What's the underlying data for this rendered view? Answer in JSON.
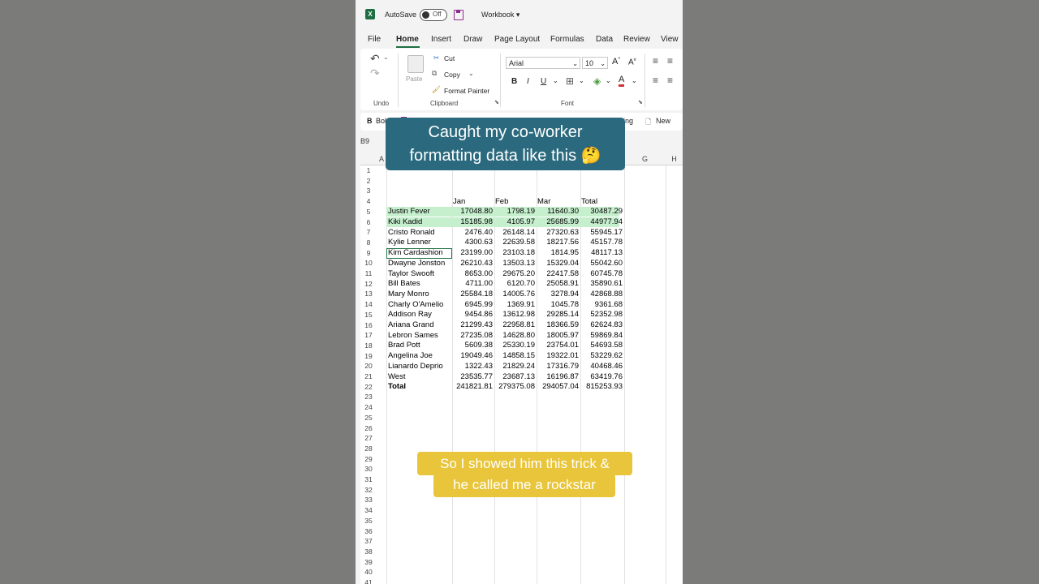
{
  "titlebar": {
    "autosave_label": "AutoSave",
    "toggle_state": "Off",
    "doc_title": "Workbook ▾"
  },
  "menu": [
    "File",
    "Home",
    "Insert",
    "Draw",
    "Page Layout",
    "Formulas",
    "Data",
    "Review",
    "View"
  ],
  "ribbon": {
    "undo_label": "Undo",
    "paste_label": "Paste",
    "cut_label": "Cut",
    "copy_label": "Copy",
    "format_painter_label": "Format Painter",
    "clipboard_label": "Clipboard",
    "font_name": "Arial",
    "font_size": "10",
    "font_group_label": "Font"
  },
  "quick_access": {
    "bold_label": "Bold",
    "spelling_label": "Spelling",
    "new_label": "New"
  },
  "name_box": "B9",
  "columns": [
    "A",
    "B",
    "C",
    "D",
    "E",
    "F",
    "G",
    "H"
  ],
  "headers": {
    "jan": "Jan",
    "feb": "Feb",
    "mar": "Mar",
    "total": "Total"
  },
  "rows": [
    [
      "Justin Fever",
      "17048.80",
      "1798.19",
      "11640.30",
      "30487.29"
    ],
    [
      "Kiki Kadid",
      "15185.98",
      "4105.97",
      "25685.99",
      "44977.94"
    ],
    [
      "Cristo Ronald",
      "2476.40",
      "26148.14",
      "27320.63",
      "55945.17"
    ],
    [
      "Kylie Lenner",
      "4300.63",
      "22639.58",
      "18217.56",
      "45157.78"
    ],
    [
      "Kim Cardashion",
      "23199.00",
      "23103.18",
      "1814.95",
      "48117.13"
    ],
    [
      "Dwayne Jonston",
      "26210.43",
      "13503.13",
      "15329.04",
      "55042.60"
    ],
    [
      "Taylor Swooft",
      "8653.00",
      "29675.20",
      "22417.58",
      "60745.78"
    ],
    [
      "Bill Bates",
      "4711.00",
      "6120.70",
      "25058.91",
      "35890.61"
    ],
    [
      "Mary Monro",
      "25584.18",
      "14005.76",
      "3278.94",
      "42868.88"
    ],
    [
      "Charly O'Amelio",
      "6945.99",
      "1369.91",
      "1045.78",
      "9361.68"
    ],
    [
      "Addison Ray",
      "9454.86",
      "13612.98",
      "29285.14",
      "52352.98"
    ],
    [
      "Ariana Grand",
      "21299.43",
      "22958.81",
      "18366.59",
      "62624.83"
    ],
    [
      "Lebron Sames",
      "27235.08",
      "14628.80",
      "18005.97",
      "59869.84"
    ],
    [
      "Brad Pott",
      "5609.38",
      "25330.19",
      "23754.01",
      "54693.58"
    ],
    [
      "Angelina Joe",
      "19049.46",
      "14858.15",
      "19322.01",
      "53229.62"
    ],
    [
      "Lianardo Deprio",
      "1322.43",
      "21829.24",
      "17316.79",
      "40468.46"
    ],
    [
      "West",
      "23535.77",
      "23687.13",
      "16196.87",
      "63419.76"
    ]
  ],
  "total_row": [
    "Total",
    "241821.81",
    "279375.08",
    "294057.04",
    "815253.93"
  ],
  "overlay_top": {
    "line1": "Caught my co-worker",
    "line2": "formatting data like this 🤔"
  },
  "overlay_bottom": {
    "line1": "So I showed him this trick &",
    "line2": "he called me a rockstar"
  },
  "colors": {
    "excel_green": "#1d6f42",
    "highlight": "#c6efce",
    "caption_blue": "#2b6a7e",
    "caption_yellow": "#e8c53a"
  }
}
